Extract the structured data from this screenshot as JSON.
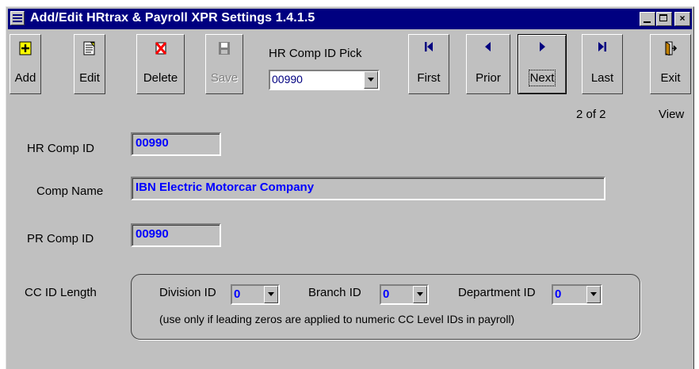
{
  "window": {
    "title": "Add/Edit HRtrax & Payroll XPR Settings 1.4.1.5",
    "controls": {
      "close_glyph": "×"
    }
  },
  "toolbar": {
    "add_label": "Add",
    "edit_label": "Edit",
    "delete_label": "Delete",
    "save_label": "Save",
    "pick_label": "HR Comp ID Pick",
    "pick_value": "00990",
    "first_label": "First",
    "prior_label": "Prior",
    "next_label": "Next",
    "last_label": "Last",
    "exit_label": "Exit"
  },
  "status": {
    "record_position": "2  of 2",
    "mode": "View"
  },
  "form": {
    "hr_comp_id_label": "HR Comp ID",
    "hr_comp_id_value": "00990",
    "comp_name_label": "Comp Name",
    "comp_name_value": "IBN Electric Motorcar Company",
    "pr_comp_id_label": "PR Comp ID",
    "pr_comp_id_value": "00990",
    "cc_id_length_label": "CC ID Length",
    "division_label": "Division ID",
    "division_value": "0",
    "branch_label": "Branch ID",
    "branch_value": "0",
    "department_label": "Department ID",
    "department_value": "0",
    "note": "(use only if leading zeros are applied to numeric CC Level IDs in payroll)"
  },
  "colors": {
    "title_bar": "#000080",
    "field_value": "#0000ff",
    "face": "#c0c0c0"
  },
  "icons": [
    "window-menu-icon",
    "add-icon",
    "edit-icon",
    "delete-icon",
    "save-icon",
    "first-icon",
    "prior-icon",
    "next-icon",
    "last-icon",
    "exit-icon"
  ]
}
